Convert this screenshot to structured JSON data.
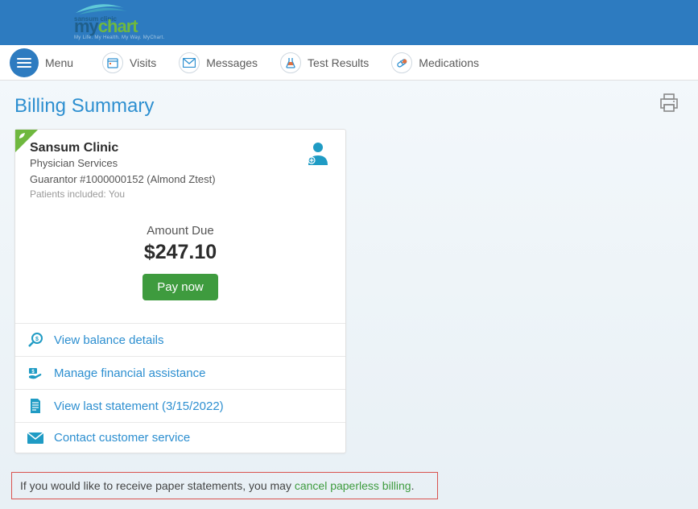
{
  "logo": {
    "pre": "sansum clinic",
    "part1": "my",
    "part2": "chart",
    "tag": "My Life. My Health. My Way. MyChart."
  },
  "nav": {
    "menu": "Menu",
    "items": [
      {
        "label": "Visits"
      },
      {
        "label": "Messages"
      },
      {
        "label": "Test Results"
      },
      {
        "label": "Medications"
      }
    ]
  },
  "page": {
    "title": "Billing Summary"
  },
  "account": {
    "provider": "Sansum Clinic",
    "service_type": "Physician Services",
    "guarantor": "Guarantor #1000000152 (Almond Ztest)",
    "patients": "Patients included: You",
    "amount_label": "Amount Due",
    "amount_value": "$247.10",
    "pay_button": "Pay now",
    "actions": {
      "balance": "View balance details",
      "assistance": "Manage financial assistance",
      "statement": "View last statement (3/15/2022)",
      "contact": "Contact customer service"
    }
  },
  "notice": {
    "prefix": "If you would like to receive paper statements, you may ",
    "link": "cancel paperless billing",
    "suffix": "."
  }
}
